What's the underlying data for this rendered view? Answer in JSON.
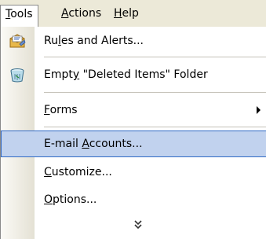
{
  "menubar": {
    "tools": {
      "label": "Tools",
      "mnemonic": "T",
      "rest": "ools"
    },
    "actions": {
      "label": "Actions",
      "mnemonic": "A",
      "rest": "ctions"
    },
    "help": {
      "label": "Help",
      "mnemonic": "H",
      "rest": "elp"
    }
  },
  "menu": {
    "rules": {
      "pre": "Ru",
      "mnemonic": "l",
      "post": "es and Alerts...",
      "icon": "rules-wizard-icon"
    },
    "empty_deleted": {
      "pre": "Empt",
      "mnemonic": "y",
      "post": " \"Deleted Items\" Folder",
      "icon": "recycle-bin-icon"
    },
    "forms": {
      "pre": "",
      "mnemonic": "F",
      "post": "orms"
    },
    "email_accounts": {
      "pre": "E-mail ",
      "mnemonic": "A",
      "post": "ccounts..."
    },
    "customize": {
      "pre": "",
      "mnemonic": "C",
      "post": "ustomize..."
    },
    "options": {
      "pre": "",
      "mnemonic": "O",
      "post": "ptions..."
    },
    "expand_icon": "double-chevron-down-icon"
  },
  "colors": {
    "highlight_fill": "#c1d2ee",
    "highlight_border": "#316ac5",
    "menubar_bg": "#ece9d8"
  }
}
